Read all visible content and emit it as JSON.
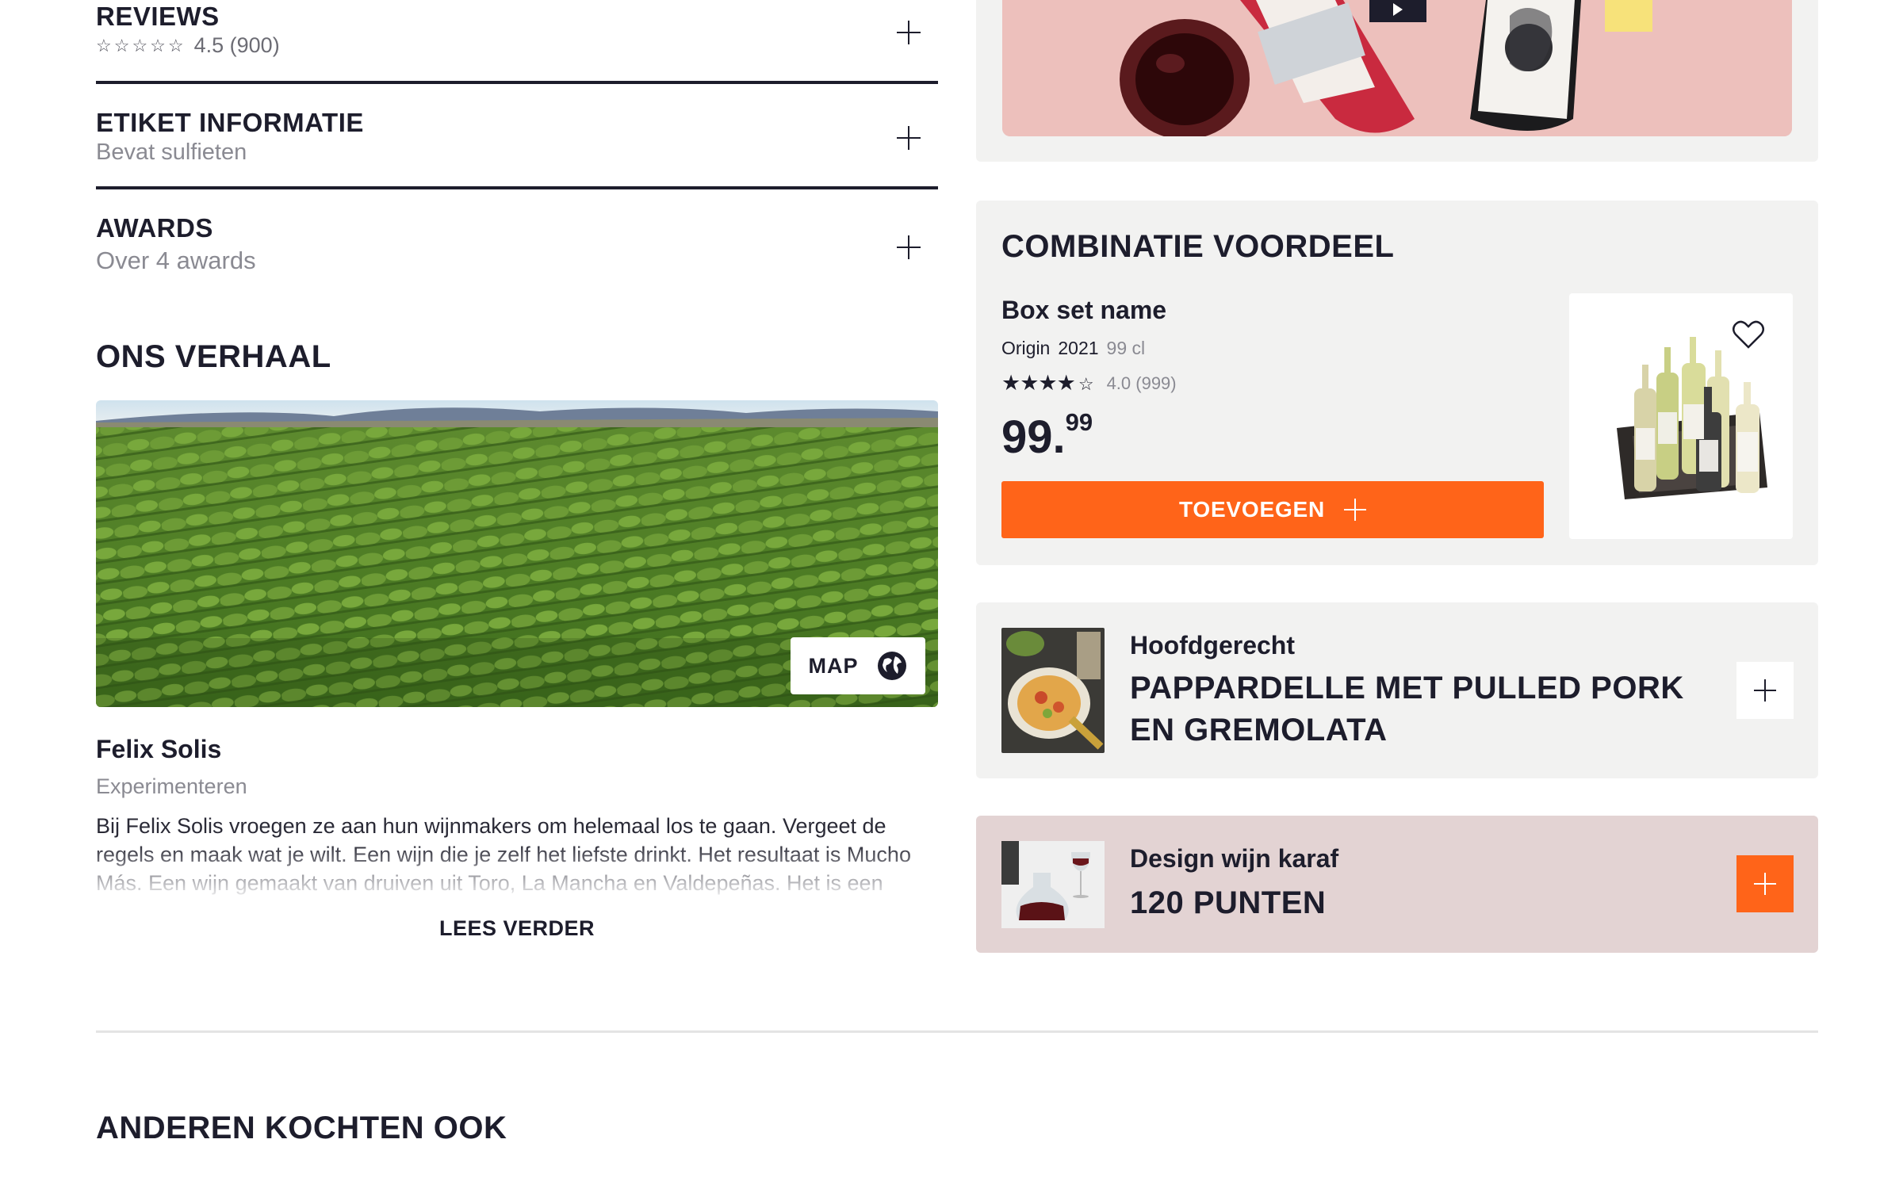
{
  "accordion": {
    "reviews": {
      "title": "REVIEWS",
      "rating": "4.5 (900)"
    },
    "label": {
      "title": "ETIKET INFORMATIE",
      "subtitle": "Bevat sulfieten"
    },
    "awards": {
      "title": "AWARDS",
      "subtitle": "Over 4 awards"
    }
  },
  "story": {
    "heading": "ONS VERHAAL",
    "map_label": "MAP",
    "winery": "Felix Solis",
    "tagline": "Experimenteren",
    "body": "Bij Felix Solis vroegen ze aan hun wijnmakers om helemaal los te gaan. Vergeet de regels en maak wat je wilt. Een wijn die je zelf het liefste drinkt. Het resultaat is Mucho Más. Een wijn gemaakt van druiven uit Toro, La Mancha en Valdepeñas. Het is een",
    "read_more": "LEES VERDER"
  },
  "combo": {
    "heading": "COMBINATIE VOORDEEL",
    "name": "Box set name",
    "origin": "Origin",
    "year": "2021",
    "volume": "99 cl",
    "rating": "4.0 (999)",
    "rating_value": 4,
    "price_main": "99",
    "price_cents": "99",
    "add_label": "TOEVOEGEN"
  },
  "recipe": {
    "category": "Hoofdgerecht",
    "title": "PAPPARDELLE MET PULLED PORK EN GREMOLATA"
  },
  "reward": {
    "name": "Design wijn karaf",
    "points": "120 PUNTEN"
  },
  "others": {
    "heading": "ANDEREN KOCHTEN OOK"
  },
  "colors": {
    "accent": "#ff6419",
    "text": "#1d1d2c",
    "panel": "#f2f2f1",
    "reward_panel": "#e3d3d3"
  }
}
